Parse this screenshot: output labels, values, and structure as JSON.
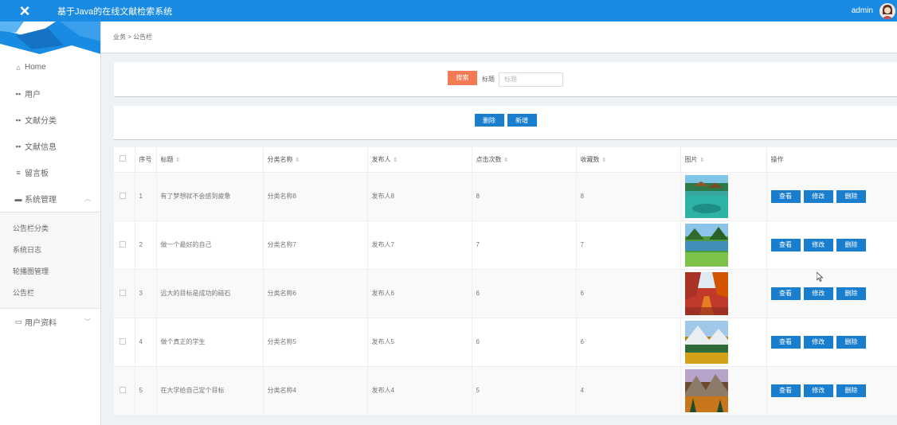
{
  "header": {
    "close_icon": "×",
    "title": "基于Java的在线文献检索系统",
    "user": "admin"
  },
  "sidebar": {
    "items": [
      {
        "icon": "home-icon",
        "label": "Home"
      },
      {
        "icon": "grid-icon",
        "label": "用户"
      },
      {
        "icon": "grid-icon",
        "label": "文献分类"
      },
      {
        "icon": "grid-icon",
        "label": "文献信息"
      },
      {
        "icon": "list-icon",
        "label": "留言板"
      },
      {
        "icon": "briefcase-icon",
        "label": "系统管理"
      }
    ],
    "sub_items": [
      "公告栏分类",
      "系统日志",
      "轮播图管理",
      "公告栏"
    ],
    "profile": {
      "icon": "card-icon",
      "label": "用户资料"
    }
  },
  "breadcrumb": "业务 > 公告栏",
  "search": {
    "button": "搜索",
    "label": "标题",
    "placeholder": "标题"
  },
  "actions": {
    "delete": "删除",
    "add": "新增"
  },
  "table": {
    "headers": [
      "序号",
      "标题",
      "分类名称",
      "发布人",
      "点击次数",
      "收藏数",
      "图片",
      "操作"
    ],
    "rows": [
      {
        "no": "1",
        "title": "有了梦想就不会感到疲惫",
        "category": "分类名称8",
        "publisher": "发布人8",
        "clicks": "8",
        "favorites": "8",
        "image": "tropical-lagoon"
      },
      {
        "no": "2",
        "title": "做一个最好的自己",
        "category": "分类名称7",
        "publisher": "发布人7",
        "clicks": "7",
        "favorites": "7",
        "image": "green-lake"
      },
      {
        "no": "3",
        "title": "远大的目标是成功的磁石",
        "category": "分类名称6",
        "publisher": "发布人6",
        "clicks": "6",
        "favorites": "6",
        "image": "autumn-path"
      },
      {
        "no": "4",
        "title": "做个真正的学生",
        "category": "分类名称5",
        "publisher": "发布人5",
        "clicks": "6",
        "favorites": "6",
        "image": "mountain-valley"
      },
      {
        "no": "5",
        "title": "在大学给自己定个目标",
        "category": "分类名称4",
        "publisher": "发布人4",
        "clicks": "5",
        "favorites": "4",
        "image": "autumn-peaks"
      }
    ],
    "row_actions": {
      "view": "查看",
      "edit": "修改",
      "delete": "删除"
    }
  },
  "colors": {
    "header": "#1a8be3",
    "button_blue": "#1a7ecf",
    "button_search": "#f37a52"
  }
}
